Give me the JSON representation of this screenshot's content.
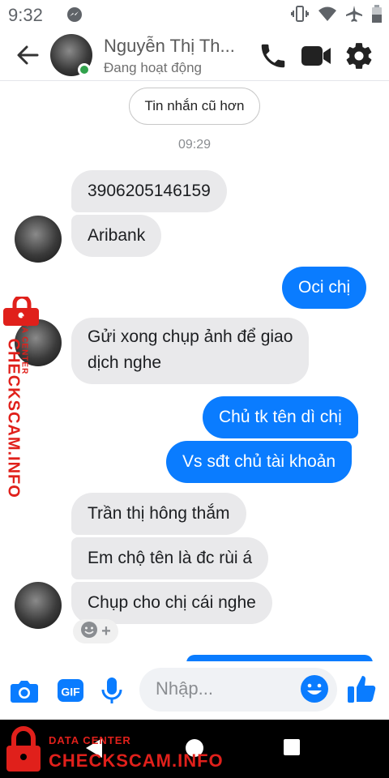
{
  "status_bar": {
    "time": "9:32"
  },
  "header": {
    "contact_name": "Nguyễn Thị Th...",
    "contact_status": "Đang hoạt động"
  },
  "chat": {
    "older_messages_label": "Tin nhắn cũ hơn",
    "timestamp": "09:29",
    "messages": [
      {
        "side": "in",
        "text": "3906205146159"
      },
      {
        "side": "in",
        "text": "Aribank"
      },
      {
        "side": "out",
        "text": "Oci chị"
      },
      {
        "side": "in",
        "line1": "Gửi xong chụp ảnh để giao",
        "line2": "dịch nghe"
      },
      {
        "side": "out",
        "text": "Chủ tk tên dì chị"
      },
      {
        "side": "out",
        "text": "Vs sđt chủ tài khoản"
      },
      {
        "side": "in",
        "text": "Trần thị hông thắm"
      },
      {
        "side": "in",
        "text": "Em chộ tên là đc rùi á"
      },
      {
        "side": "in",
        "text": "Chụp cho chị cái nghe"
      }
    ],
    "reaction_add": "+"
  },
  "composer": {
    "placeholder": "Nhập...",
    "gif_label": "GIF"
  },
  "watermark": {
    "subtitle": "DATA CENTER",
    "title": "CHECKSCAM.INFO",
    "color": "#e0201b"
  },
  "colors": {
    "outgoing_bubble": "#0a7cff",
    "incoming_bubble": "#e9e9eb",
    "accent": "#0a7cff",
    "online": "#31a24c"
  }
}
